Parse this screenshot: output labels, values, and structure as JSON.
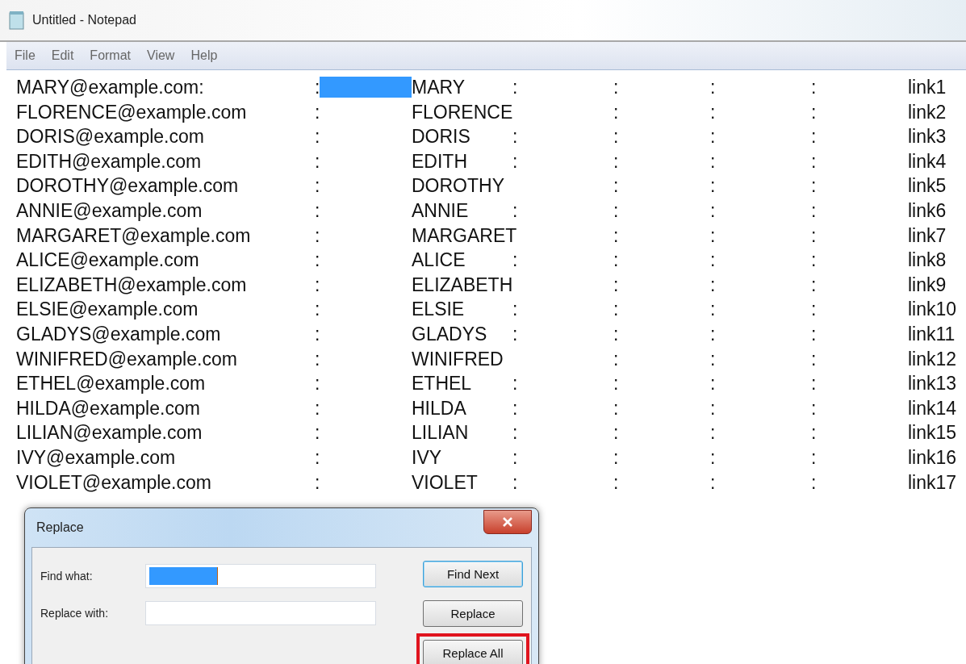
{
  "window": {
    "title": "Untitled - Notepad"
  },
  "menu": [
    "File",
    "Edit",
    "Format",
    "View",
    "Help"
  ],
  "lines": [
    {
      "email": "MARY@example.com:",
      "colon_1": ":",
      "tab_selected": true,
      "name": "MARY",
      "colon_2": ":",
      "colon_3": ":",
      "colon_4": ":",
      "colon_5": ":",
      "link": "link1"
    },
    {
      "email": "FLORENCE@example.com",
      "colon_1": ":",
      "tab_selected": false,
      "name": "FLORENCE",
      "colon_3": ":",
      "colon_4": ":",
      "colon_5": ":",
      "link": "link2"
    },
    {
      "email": "DORIS@example.com",
      "colon_1": ":",
      "tab_selected": false,
      "name": "DORIS",
      "colon_2": ":",
      "colon_3": ":",
      "colon_4": ":",
      "colon_5": ":",
      "link": "link3"
    },
    {
      "email": "EDITH@example.com",
      "colon_1": ":",
      "tab_selected": false,
      "name": "EDITH",
      "colon_2": ":",
      "colon_3": ":",
      "colon_4": ":",
      "colon_5": ":",
      "link": "link4"
    },
    {
      "email": "DOROTHY@example.com",
      "colon_1": ":",
      "tab_selected": false,
      "name": "DOROTHY",
      "colon_3": ":",
      "colon_4": ":",
      "colon_5": ":",
      "link": "link5"
    },
    {
      "email": "ANNIE@example.com",
      "colon_1": ":",
      "tab_selected": false,
      "name": "ANNIE",
      "colon_2": ":",
      "colon_3": ":",
      "colon_4": ":",
      "colon_5": ":",
      "link": "link6"
    },
    {
      "email": "MARGARET@example.com",
      "colon_1": ":",
      "tab_selected": false,
      "name": "MARGARET",
      "colon_3": ":",
      "colon_4": ":",
      "colon_5": ":",
      "link": "link7"
    },
    {
      "email": "ALICE@example.com",
      "colon_1": ":",
      "tab_selected": false,
      "name": "ALICE",
      "colon_2": ":",
      "colon_3": ":",
      "colon_4": ":",
      "colon_5": ":",
      "link": "link8"
    },
    {
      "email": "ELIZABETH@example.com",
      "colon_1": ":",
      "tab_selected": false,
      "name": "ELIZABETH",
      "colon_3": ":",
      "colon_4": ":",
      "colon_5": ":",
      "link": "link9"
    },
    {
      "email": "ELSIE@example.com",
      "colon_1": ":",
      "tab_selected": false,
      "name": "ELSIE",
      "colon_2": ":",
      "colon_3": ":",
      "colon_4": ":",
      "colon_5": ":",
      "link": "link10"
    },
    {
      "email": "GLADYS@example.com",
      "colon_1": ":",
      "tab_selected": false,
      "name": "GLADYS",
      "colon_2": ":",
      "colon_3": ":",
      "colon_4": ":",
      "colon_5": ":",
      "link": "link11"
    },
    {
      "email": "WINIFRED@example.com",
      "colon_1": ":",
      "tab_selected": false,
      "name": "WINIFRED",
      "colon_3": ":",
      "colon_4": ":",
      "colon_5": ":",
      "link": "link12"
    },
    {
      "email": "ETHEL@example.com",
      "colon_1": ":",
      "tab_selected": false,
      "name": "ETHEL",
      "colon_2": ":",
      "colon_3": ":",
      "colon_4": ":",
      "colon_5": ":",
      "link": "link13"
    },
    {
      "email": "HILDA@example.com",
      "colon_1": ":",
      "tab_selected": false,
      "name": "HILDA",
      "colon_2": ":",
      "colon_3": ":",
      "colon_4": ":",
      "colon_5": ":",
      "link": "link14"
    },
    {
      "email": "LILIAN@example.com",
      "colon_1": ":",
      "tab_selected": false,
      "name": "LILIAN",
      "colon_2": ":",
      "colon_3": ":",
      "colon_4": ":",
      "colon_5": ":",
      "link": "link15"
    },
    {
      "email": "IVY@example.com",
      "colon_1": ":",
      "tab_selected": false,
      "name": "IVY",
      "colon_2": ":",
      "colon_3": ":",
      "colon_4": ":",
      "colon_5": ":",
      "link": "link16"
    },
    {
      "email": "VIOLET@example.com",
      "colon_1": ":",
      "tab_selected": false,
      "name": "VIOLET",
      "colon_2": ":",
      "colon_3": ":",
      "colon_4": ":",
      "colon_5": ":",
      "link": "link17"
    }
  ],
  "dialog": {
    "title": "Replace",
    "fields": [
      {
        "label": "Find what:",
        "value_selected": true
      },
      {
        "label": "Replace with:",
        "value_selected": false
      }
    ],
    "buttons": [
      {
        "label": "Find Next",
        "default": true,
        "highlighted": false
      },
      {
        "label": "Replace",
        "default": false,
        "highlighted": false
      },
      {
        "label": "Replace All",
        "default": false,
        "highlighted": true
      }
    ]
  }
}
